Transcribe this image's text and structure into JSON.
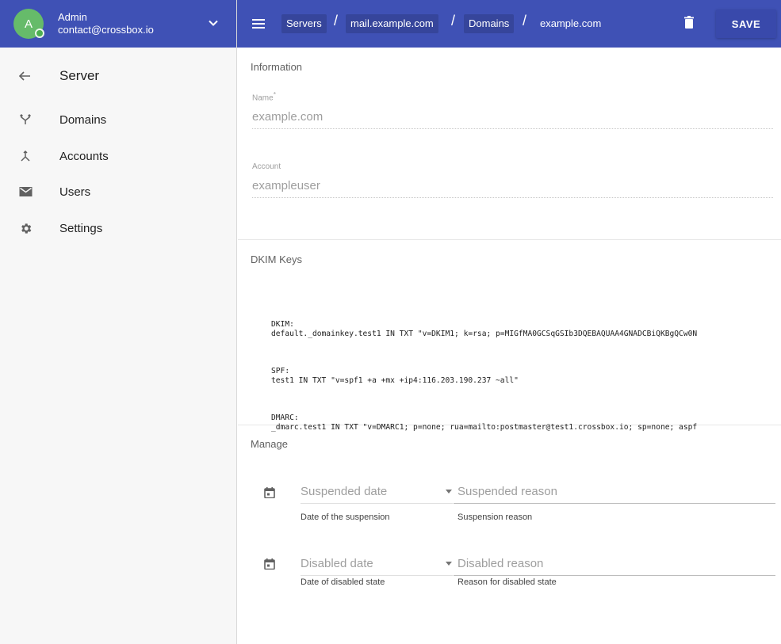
{
  "user": {
    "initial": "A",
    "name": "Admin",
    "email": "contact@crossbox.io"
  },
  "sidebar": {
    "title": "Server",
    "items": [
      {
        "label": "Domains",
        "icon": "fork-icon"
      },
      {
        "label": "Accounts",
        "icon": "merge-icon"
      },
      {
        "label": "Users",
        "icon": "mail-icon"
      },
      {
        "label": "Settings",
        "icon": "gear-icon"
      }
    ]
  },
  "breadcrumb": {
    "items": [
      "Servers",
      "mail.example.com",
      "Domains",
      "example.com"
    ],
    "separator": "/"
  },
  "toolbar": {
    "save_label": "SAVE"
  },
  "information": {
    "title": "Information",
    "name_label": "Name",
    "name_required_mark": "*",
    "name_value": "example.com",
    "account_label": "Account",
    "account_value": "exampleuser"
  },
  "dkim": {
    "title": "DKIM Keys",
    "blocks": [
      {
        "label": "DKIM:",
        "record": "default._domainkey.test1 IN TXT \"v=DKIM1; k=rsa; p=MIGfMA0GCSqGSIb3DQEBAQUAA4GNADCBiQKBgQCw0N"
      },
      {
        "label": "SPF:",
        "record": "test1 IN TXT \"v=spf1 +a +mx +ip4:116.203.190.237 ~all\""
      },
      {
        "label": "DMARC:",
        "record": "_dmarc.test1 IN TXT \"v=DMARC1; p=none; rua=mailto:postmaster@test1.crossbox.io; sp=none; aspf"
      }
    ]
  },
  "manage": {
    "title": "Manage",
    "suspended": {
      "date_placeholder": "Suspended date",
      "date_helper": "Date of the suspension",
      "reason_placeholder": "Suspended reason",
      "reason_helper": "Suspension reason"
    },
    "disabled": {
      "date_placeholder": "Disabled date",
      "date_helper": "Date of disabled state",
      "reason_placeholder": "Disabled reason",
      "reason_helper": "Reason for disabled state"
    }
  },
  "colors": {
    "primary": "#3f51b5",
    "avatar": "#66bb6a"
  }
}
